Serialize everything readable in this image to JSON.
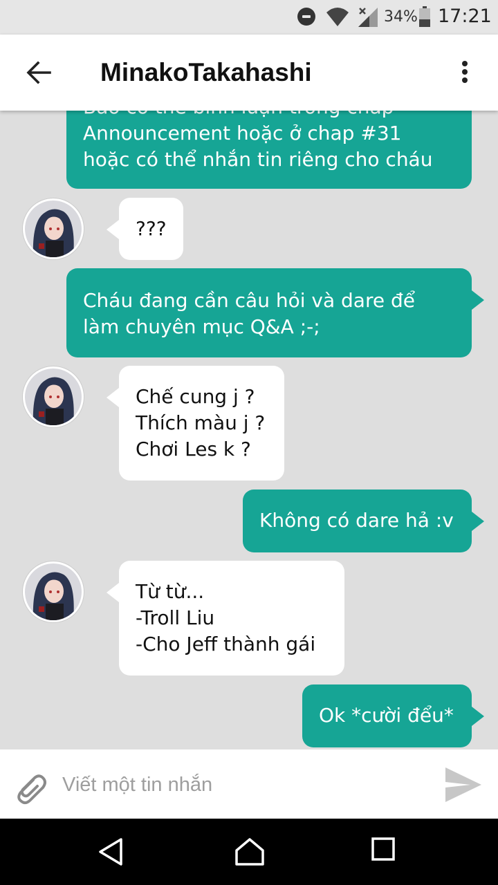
{
  "status_bar": {
    "battery": "34%",
    "time": "17:21"
  },
  "header": {
    "title": "MinakoTakahashi",
    "back_icon": "arrow-back-icon",
    "menu_icon": "more-vert-icon"
  },
  "colors": {
    "sent_bubble": "#16a595",
    "received_bubble": "#ffffff",
    "chat_background": "#dedede"
  },
  "messages": [
    {
      "direction": "sent",
      "lines": [
        "Báo cô thể bình luận trong chap",
        "Announcement hoặc ở chap #31",
        "hoặc có thể nhắn tin riêng cho cháu"
      ]
    },
    {
      "direction": "received",
      "lines": [
        "???"
      ]
    },
    {
      "direction": "sent",
      "lines": [
        "Cháu đang cần câu hỏi và dare để",
        "làm chuyên mục Q&A ;-;"
      ]
    },
    {
      "direction": "received",
      "lines": [
        "Chế cung j ?",
        "Thích màu j ?",
        "Chơi Les k ?"
      ]
    },
    {
      "direction": "sent",
      "lines": [
        "Không có dare hả :v"
      ]
    },
    {
      "direction": "received",
      "lines": [
        "Từ từ...",
        "-Troll Liu",
        "-Cho Jeff thành gái"
      ]
    },
    {
      "direction": "sent",
      "lines": [
        "Ok *cười đểu*"
      ]
    }
  ],
  "composer": {
    "placeholder": "Viết một tin nhắn",
    "value": "",
    "attach_icon": "paperclip-icon",
    "send_icon": "send-icon"
  },
  "navbar": {
    "back_icon": "nav-back-icon",
    "home_icon": "nav-home-icon",
    "recents_icon": "nav-recents-icon"
  }
}
